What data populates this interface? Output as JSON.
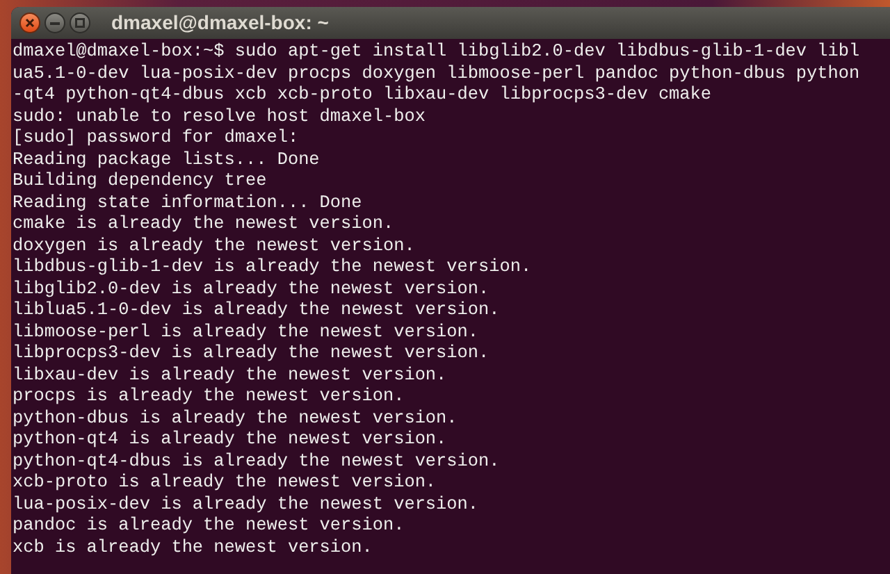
{
  "window": {
    "title": "dmaxel@dmaxel-box: ~"
  },
  "terminal": {
    "lines": [
      "dmaxel@dmaxel-box:~$ sudo apt-get install libglib2.0-dev libdbus-glib-1-dev libl",
      "ua5.1-0-dev lua-posix-dev procps doxygen libmoose-perl pandoc python-dbus python",
      "-qt4 python-qt4-dbus xcb xcb-proto libxau-dev libprocps3-dev cmake",
      "sudo: unable to resolve host dmaxel-box",
      "[sudo] password for dmaxel:",
      "Reading package lists... Done",
      "Building dependency tree",
      "Reading state information... Done",
      "cmake is already the newest version.",
      "doxygen is already the newest version.",
      "libdbus-glib-1-dev is already the newest version.",
      "libglib2.0-dev is already the newest version.",
      "liblua5.1-0-dev is already the newest version.",
      "libmoose-perl is already the newest version.",
      "libprocps3-dev is already the newest version.",
      "libxau-dev is already the newest version.",
      "procps is already the newest version.",
      "python-dbus is already the newest version.",
      "python-qt4 is already the newest version.",
      "python-qt4-dbus is already the newest version.",
      "xcb-proto is already the newest version.",
      "lua-posix-dev is already the newest version.",
      "pandoc is already the newest version.",
      "xcb is already the newest version."
    ]
  }
}
